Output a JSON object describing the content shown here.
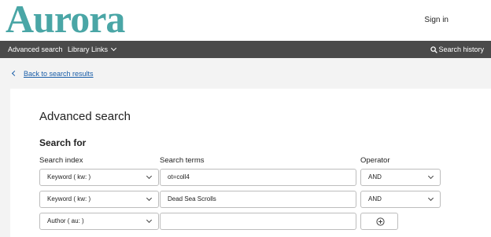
{
  "header": {
    "logo_text": "Aurora",
    "signin_label": "Sign in"
  },
  "nav": {
    "advanced_search": "Advanced search",
    "library_links": "Library Links",
    "search_history": "Search history"
  },
  "back_link": "Back to search results",
  "page": {
    "title": "Advanced search",
    "subtitle": "Search for",
    "col_index": "Search index",
    "col_terms": "Search terms",
    "col_operator": "Operator"
  },
  "rows": [
    {
      "index": "Keyword ( kw: )",
      "terms": "ot=coll4",
      "operator": "AND"
    },
    {
      "index": "Keyword ( kw: )",
      "terms": "Dead Sea Scrolls",
      "operator": "AND"
    },
    {
      "index": "Author ( au: )",
      "terms": "",
      "operator": ""
    }
  ],
  "colors": {
    "logo": "#4aa6a6",
    "nav_bg": "#4a4a4a",
    "link": "#1a5ea8"
  }
}
